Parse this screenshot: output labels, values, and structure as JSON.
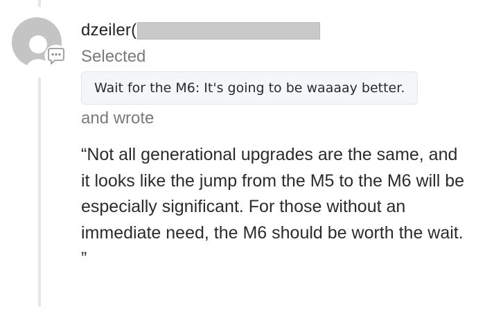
{
  "comment": {
    "username": "dzeiler(",
    "action_label": "Selected",
    "selected_quote": "Wait for the M6: It's going to be waaaay better.",
    "wrote_label": "and wrote",
    "body": "“Not all generational upgrades are the same, and it looks like the jump from the M5 to the M6 will be especially significant. For those without an immediate need, the M6 should be worth the wait. ”"
  },
  "icons": {
    "avatar": "default-avatar-icon",
    "comment_badge": "speech-bubble-icon"
  },
  "colors": {
    "avatar_gray": "#c4c4c4",
    "redaction_gray": "#c9c9c9",
    "muted_text": "#7a7a7a",
    "quote_background": "#f5f6f8"
  }
}
